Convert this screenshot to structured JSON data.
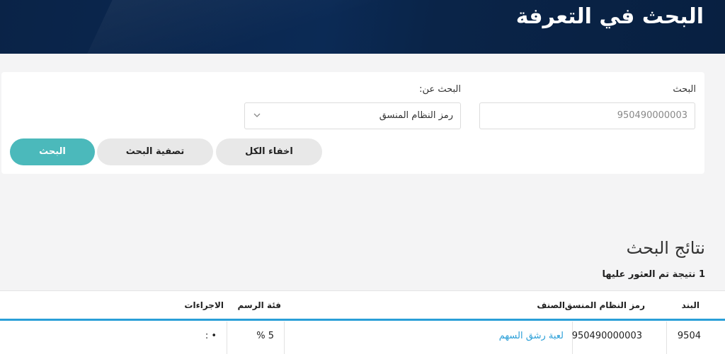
{
  "header": {
    "title": "البحث في التعرفة"
  },
  "form": {
    "search_label": "البحث",
    "search_value": "950490000003",
    "search_by_label": "البحث عن:",
    "search_by_selected": "رمز النظام المنسق",
    "hide_all_label": "اخفاء الكل",
    "filter_label": "تصفية البحث",
    "search_button_label": "البحث"
  },
  "results": {
    "title": "نتائج البحث",
    "count_text": "1 نتيجة تم العثور عليها",
    "columns": [
      "البند",
      "رمز النظام المنسق",
      "الصنف",
      "فئة الرسم",
      "الاجراءات"
    ],
    "rows": [
      {
        "item": "9504",
        "hs_code": "950490000003",
        "category": "لعبة رشق السهم",
        "fee": "5 %",
        "actions": "• :"
      }
    ]
  },
  "icons": {
    "select_arrow": "chevron-down-icon"
  },
  "colors": {
    "header_bg": "#0b2a55",
    "accent": "#4bb9bb",
    "table_rule": "#2a9fd8"
  }
}
